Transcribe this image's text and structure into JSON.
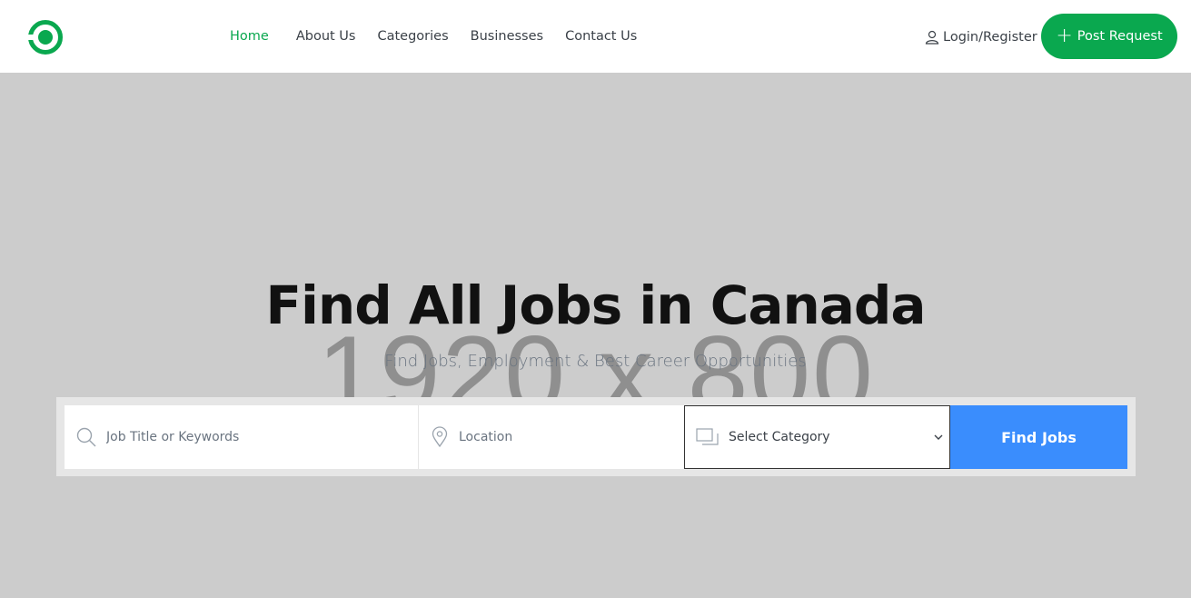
{
  "nav": {
    "items": [
      {
        "label": "Home",
        "active": true
      },
      {
        "label": "About Us",
        "active": false
      },
      {
        "label": "Categories",
        "active": false
      },
      {
        "label": "Businesses",
        "active": false
      },
      {
        "label": "Contact Us",
        "active": false
      }
    ],
    "login_label": "Login/Register",
    "post_button_label": "Post Request",
    "post_button_icon": "plus-icon"
  },
  "hero": {
    "placeholder_text": "1920 x 800",
    "title": "Find All Jobs in Canada",
    "subtitle": "Find Jobs, Employment & Best Career Opportunities"
  },
  "search": {
    "keyword_placeholder": "Job Title or Keywords",
    "location_placeholder": "Location",
    "category_selected": "Select Category",
    "submit_label": "Find Jobs"
  },
  "colors": {
    "brand_green": "#0aa84f",
    "button_blue": "#3a8dfd",
    "hero_background": "#cccccc"
  }
}
